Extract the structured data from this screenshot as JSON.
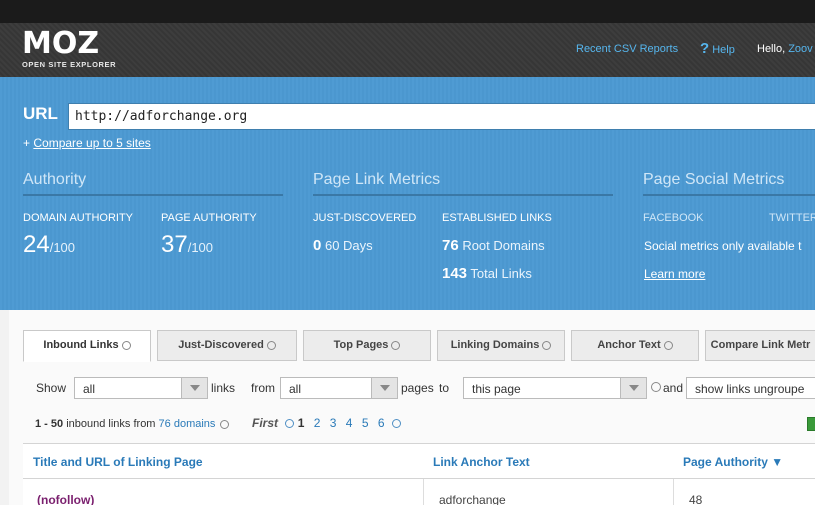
{
  "header": {
    "logo": "MOZ",
    "logo_sub": "OPEN SITE EXPLORER",
    "recent_csv": "Recent CSV Reports",
    "help_glyph": "?",
    "help": "Help",
    "hello": "Hello,",
    "user": "Zoov"
  },
  "search": {
    "label": "URL",
    "value": "http://adforchange.org",
    "compare_prefix": "+",
    "compare_link": "Compare up to 5 sites"
  },
  "authority": {
    "title": "Authority",
    "da_label": "DOMAIN AUTHORITY",
    "da_value": "24",
    "da_max": "/100",
    "pa_label": "PAGE AUTHORITY",
    "pa_value": "37",
    "pa_max": "/100"
  },
  "page_link_metrics": {
    "title": "Page Link Metrics",
    "jd_label": "JUST-DISCOVERED",
    "jd_value": "0",
    "jd_unit": "60 Days",
    "est_label": "ESTABLISHED LINKS",
    "root_value": "76",
    "root_unit": "Root Domains",
    "total_value": "143",
    "total_unit": "Total Links"
  },
  "social": {
    "title": "Page Social Metrics",
    "facebook": "FACEBOOK",
    "twitter": "TWITTER",
    "note": "Social metrics only available t",
    "learn_more": "Learn more"
  },
  "tabs": [
    {
      "label": "Inbound Links"
    },
    {
      "label": "Just-Discovered"
    },
    {
      "label": "Top Pages"
    },
    {
      "label": "Linking Domains"
    },
    {
      "label": "Anchor Text"
    },
    {
      "label": "Compare Link Metr"
    }
  ],
  "filters": {
    "show": "Show",
    "sel1": "all",
    "links": "links",
    "from": "from",
    "sel2": "all",
    "pages": "pages",
    "to": "to",
    "sel3": "this page",
    "and": "and",
    "sel4": "show links ungroupe"
  },
  "results": {
    "range": "1 - 50",
    "text": "inbound links from",
    "domains": "76 domains"
  },
  "pager": {
    "first": "First",
    "pages": [
      "1",
      "2",
      "3",
      "4",
      "5",
      "6"
    ]
  },
  "table": {
    "col1": "Title and URL of Linking Page",
    "col2": "Link Anchor Text",
    "col3": "Page Authority",
    "sort_glyph": "▼",
    "row1": {
      "title": "(nofollow)",
      "anchor": "adforchange",
      "pa": "48"
    }
  },
  "colors": {
    "accent": "#4f9bd3",
    "link": "#2a7ab8",
    "header": "#3a3a3a"
  }
}
